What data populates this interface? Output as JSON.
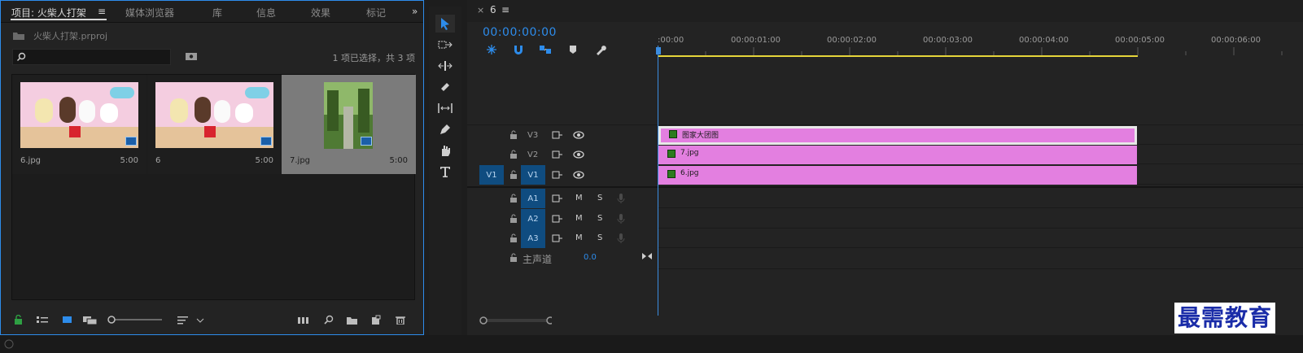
{
  "project_panel": {
    "tabs": [
      {
        "label": "项目: 火柴人打架"
      },
      {
        "label": "媒体浏览器"
      },
      {
        "label": "库"
      },
      {
        "label": "信息"
      },
      {
        "label": "效果"
      },
      {
        "label": "标记"
      }
    ],
    "menu_glyph": "≡",
    "overflow_glyph": "»",
    "project_file": "火柴人打架.prproj",
    "search_value": "",
    "selection_status": "1 项已选择，共 3 项",
    "clips": [
      {
        "name": "6.jpg",
        "duration": "5:00",
        "selected": false
      },
      {
        "name": "6",
        "duration": "5:00",
        "selected": false
      },
      {
        "name": "7.jpg",
        "duration": "5:00",
        "selected": true
      }
    ]
  },
  "timeline": {
    "tab_close": "×",
    "sequence_name": "6",
    "menu_glyph": "≡",
    "timecode": "00:00:00:00",
    "ruler_labels": [
      ":00:00",
      "00:00:01:00",
      "00:00:02:00",
      "00:00:03:00",
      "00:00:04:00",
      "00:00:05:00",
      "00:00:06:00"
    ],
    "video_tracks": [
      {
        "label": "V3",
        "source": "",
        "clip": "图家大团图"
      },
      {
        "label": "V2",
        "source": "",
        "clip": "7.jpg"
      },
      {
        "label": "V1",
        "source": "V1",
        "clip": "6.jpg"
      }
    ],
    "audio_tracks": [
      {
        "label": "A1",
        "mute": "M",
        "solo": "S"
      },
      {
        "label": "A2",
        "mute": "M",
        "solo": "S"
      },
      {
        "label": "A3",
        "mute": "M",
        "solo": "S"
      }
    ],
    "master_label": "主声道",
    "master_value": "0.0"
  },
  "tools": [
    "selection-tool",
    "track-select-tool",
    "ripple-edit-tool",
    "razor-tool",
    "slip-tool",
    "pen-tool",
    "hand-tool",
    "type-tool"
  ],
  "colors": {
    "accent": "#2d8ceb",
    "clip": "#e37fe0",
    "work_area": "#e6d53a"
  },
  "watermark": "最需教育"
}
